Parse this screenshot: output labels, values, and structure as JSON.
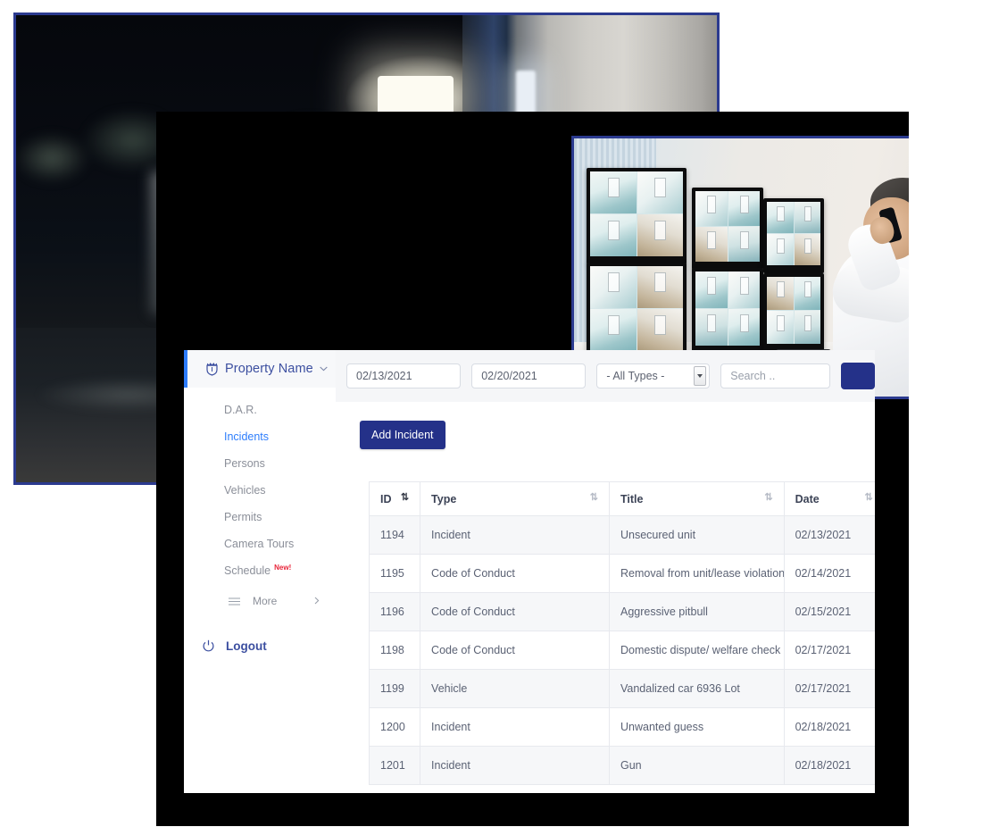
{
  "theme": {
    "brand_blue": "#243189",
    "accent_blue": "#2d7dfc",
    "photo_border": "#2b3a8f",
    "backdrop": "#000000",
    "new_badge_red": "#e8253a"
  },
  "photos": [
    {
      "name": "security-guard-night-photo",
      "alt": "Security guard with radio at night"
    },
    {
      "name": "control-room-operator-photo",
      "alt": "Operator on phone watching CCTV monitor wall"
    }
  ],
  "sidebar": {
    "property_title": "Property Name",
    "shield_icon": "shield-icon",
    "caret_icon": "chevron-down-icon",
    "items": [
      {
        "label": "D.A.R.",
        "active": false
      },
      {
        "label": "Incidents",
        "active": true
      },
      {
        "label": "Persons",
        "active": false
      },
      {
        "label": "Vehicles",
        "active": false
      },
      {
        "label": "Permits",
        "active": false
      },
      {
        "label": "Camera Tours",
        "active": false
      },
      {
        "label": "Schedule",
        "active": false,
        "badge": "New!"
      }
    ],
    "more": {
      "label": "More",
      "menu_icon": "hamburger-icon",
      "chevron_icon": "chevron-right-icon"
    },
    "logout": {
      "label": "Logout",
      "icon": "power-icon"
    }
  },
  "filters": {
    "start_date": "02/13/2021",
    "end_date": "02/20/2021",
    "type_select": {
      "value": "- All Types -",
      "options": [
        "- All Types -"
      ],
      "icon": "dropdown-arrow-icon"
    },
    "search": {
      "value": "",
      "placeholder": "Search .."
    },
    "go_button_label": ""
  },
  "toolbar": {
    "add_incident_label": "Add Incident"
  },
  "table": {
    "sort_icon": "sort-updown-icon",
    "sorted_column": "ID",
    "sort_direction": "asc",
    "columns": [
      "ID",
      "Type",
      "Title",
      "Date"
    ],
    "rows": [
      {
        "id": "1194",
        "type": "Incident",
        "title": "Unsecured unit",
        "date": "02/13/2021"
      },
      {
        "id": "1195",
        "type": "Code of Conduct",
        "title": "Removal from unit/lease violation",
        "date": "02/14/2021"
      },
      {
        "id": "1196",
        "type": "Code of Conduct",
        "title": "Aggressive pitbull",
        "date": "02/15/2021"
      },
      {
        "id": "1198",
        "type": "Code of Conduct",
        "title": "Domestic dispute/ welfare check",
        "date": "02/17/2021"
      },
      {
        "id": "1199",
        "type": "Vehicle",
        "title": "Vandalized car 6936 Lot",
        "date": "02/17/2021"
      },
      {
        "id": "1200",
        "type": "Incident",
        "title": "Unwanted guess",
        "date": "02/18/2021"
      },
      {
        "id": "1201",
        "type": "Incident",
        "title": "Gun",
        "date": "02/18/2021"
      }
    ]
  }
}
